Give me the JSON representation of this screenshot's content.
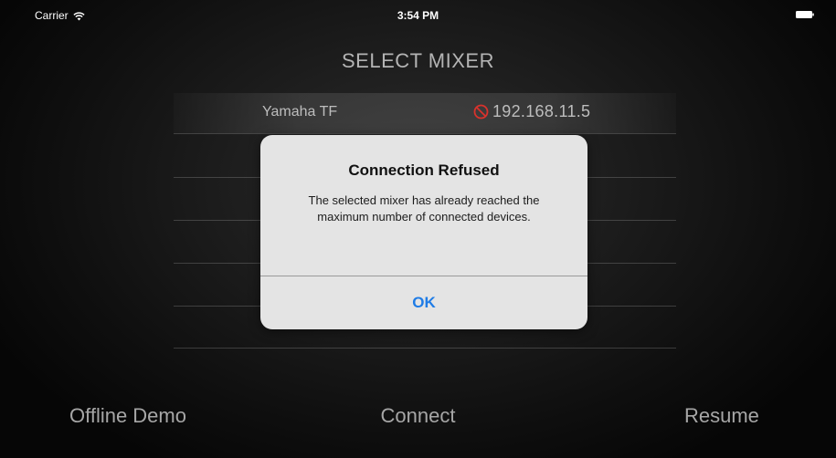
{
  "status_bar": {
    "carrier": "Carrier",
    "time": "3:54 PM",
    "icons": [
      "wifi-icon",
      "battery-icon"
    ]
  },
  "screen_title": "SELECT MIXER",
  "mixers": [
    {
      "name": "Yamaha TF",
      "ip": "192.168.11.5",
      "status_icon": "blocked-icon",
      "selected": true
    }
  ],
  "bottom_bar": {
    "offline_demo_label": "Offline Demo",
    "connect_label": "Connect",
    "resume_label": "Resume"
  },
  "alert": {
    "title": "Connection Refused",
    "message": "The selected mixer has already reached the maximum number of connected devices.",
    "ok_label": "OK"
  },
  "colors": {
    "alert_background": "#e4e4e4",
    "ok_blue": "#1f7ce6",
    "blocked_red": "#d8322c",
    "muted_text": "#b4b4b4"
  }
}
